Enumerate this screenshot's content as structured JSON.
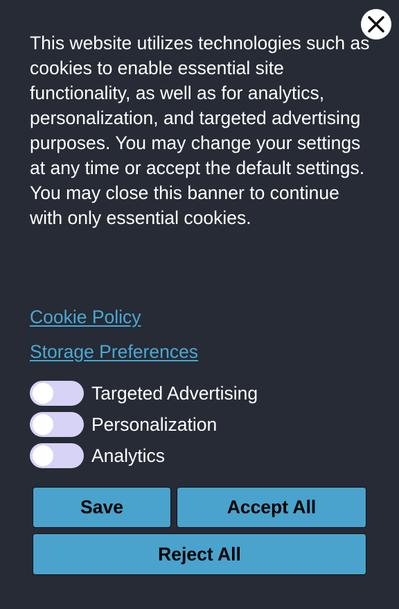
{
  "banner": {
    "message": "This website utilizes technologies such as cookies to enable essential site functionality, as well as for analytics, personalization, and targeted advertising purposes. You may change your settings at any time or accept the default settings. You may close this banner to continue with only essential cookies.",
    "close_icon": "close-icon",
    "links": {
      "cookie_policy": "Cookie Policy",
      "storage_preferences": "Storage Preferences"
    },
    "toggles": [
      {
        "label": "Targeted Advertising",
        "on": false
      },
      {
        "label": "Personalization",
        "on": false
      },
      {
        "label": "Analytics",
        "on": false
      }
    ],
    "buttons": {
      "save": "Save",
      "accept_all": "Accept All",
      "reject_all": "Reject All"
    }
  },
  "colors": {
    "background": "#262b35",
    "text": "#ffffff",
    "link": "#4aa8d2",
    "button": "#4aa3cc",
    "toggle_track": "#d6d3f7"
  }
}
